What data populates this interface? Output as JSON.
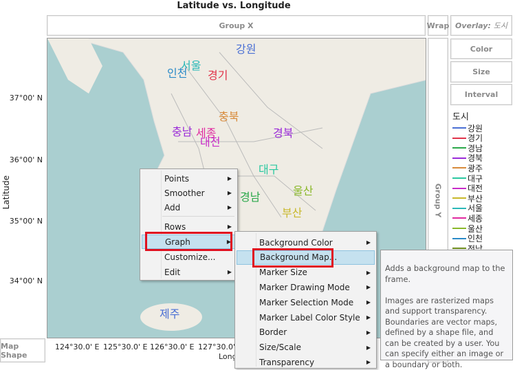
{
  "title": "Latitude vs. Longitude",
  "group_x": "Group X",
  "group_y": "Group Y",
  "wrap": "Wrap",
  "overlay": {
    "label": "Overlay:",
    "value": "도시"
  },
  "buttons": {
    "color": "Color",
    "size": "Size",
    "interval": "Interval"
  },
  "map_shape": "Map Shape",
  "y_axis": {
    "label": "Latitude",
    "ticks": [
      "37°00' N",
      "36°00' N",
      "35°00' N",
      "34°00' N"
    ]
  },
  "x_axis": {
    "label": "Long",
    "ticks": [
      "124°30.0' E",
      "125°30.0' E",
      "126°30.0' E",
      "127°30.0' E"
    ]
  },
  "legend": {
    "title": "도시",
    "items": [
      {
        "label": "강원",
        "color": "#4a6fd4"
      },
      {
        "label": "경기",
        "color": "#e0334a"
      },
      {
        "label": "경남",
        "color": "#2aa84a"
      },
      {
        "label": "경북",
        "color": "#9a2ad8"
      },
      {
        "label": "광주",
        "color": "#d88a3a"
      },
      {
        "label": "대구",
        "color": "#2ac8a0"
      },
      {
        "label": "대전",
        "color": "#c82ac8"
      },
      {
        "label": "부산",
        "color": "#c8b82a"
      },
      {
        "label": "서울",
        "color": "#2ab8b8"
      },
      {
        "label": "세종",
        "color": "#e02aa0"
      },
      {
        "label": "울산",
        "color": "#8ab82a"
      },
      {
        "label": "인천",
        "color": "#2a8ac8"
      },
      {
        "label": "전남",
        "color": "#6a8a1a"
      }
    ]
  },
  "map_labels": [
    {
      "text": "강원",
      "color": "#4a6fd4"
    },
    {
      "text": "서울",
      "color": "#2ab8b8"
    },
    {
      "text": "인천",
      "color": "#2a8ac8"
    },
    {
      "text": "경기",
      "color": "#e0334a"
    },
    {
      "text": "충북",
      "color": "#d88a3a"
    },
    {
      "text": "충남",
      "color": "#9a2ad8"
    },
    {
      "text": "세종",
      "color": "#e02aa0"
    },
    {
      "text": "대전",
      "color": "#c82ac8"
    },
    {
      "text": "경북",
      "color": "#9a2ad8"
    },
    {
      "text": "대구",
      "color": "#2ac8a0"
    },
    {
      "text": "울산",
      "color": "#8ab82a"
    },
    {
      "text": "경남",
      "color": "#2aa84a"
    },
    {
      "text": "부산",
      "color": "#c8b82a"
    },
    {
      "text": "제주",
      "color": "#4a6fd4"
    }
  ],
  "context_menu": {
    "items": [
      "Points",
      "Smoother",
      "Add",
      "Rows",
      "Graph",
      "Customize...",
      "Edit"
    ]
  },
  "graph_submenu": {
    "items": [
      "Background Color",
      "Background Map...",
      "Marker Size",
      "Marker Drawing Mode",
      "Marker Selection Mode",
      "Marker Label Color Style",
      "Border",
      "Size/Scale",
      "Transparency"
    ]
  },
  "tooltip": {
    "p1": "Adds a background map to the frame.",
    "p2": "Images are rasterized maps and support transparency.  Boundaries are vector maps, defined by a shape file, and can be created by a user. You can specify either an image or a boundary or both."
  }
}
